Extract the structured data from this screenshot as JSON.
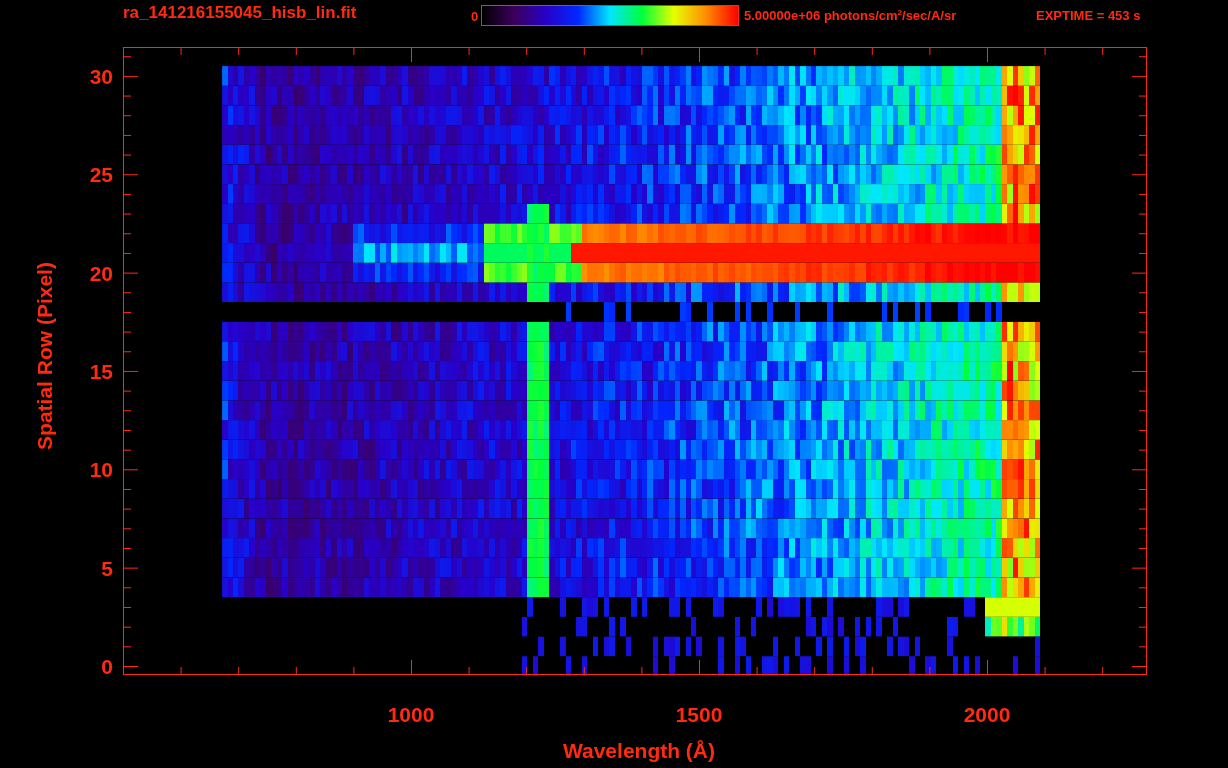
{
  "header": {
    "title": "ra_141216155045_hisb_lin.fit",
    "colorbar": {
      "min_label": "0",
      "max_label": "5.00000e+06 photons/cm$^{2}$/sec/A/sr"
    },
    "exposure": "EXPTIME = 453 s"
  },
  "plot": {
    "x_axis": {
      "title": "Wavelength (Å)",
      "tick_labels": [
        "1000",
        "1500",
        "2000"
      ]
    },
    "y_axis": {
      "title": "Spatial Row (Pixel)",
      "tick_labels": [
        "30",
        "25",
        "20",
        "15",
        "10",
        "5",
        "0"
      ]
    }
  }
}
